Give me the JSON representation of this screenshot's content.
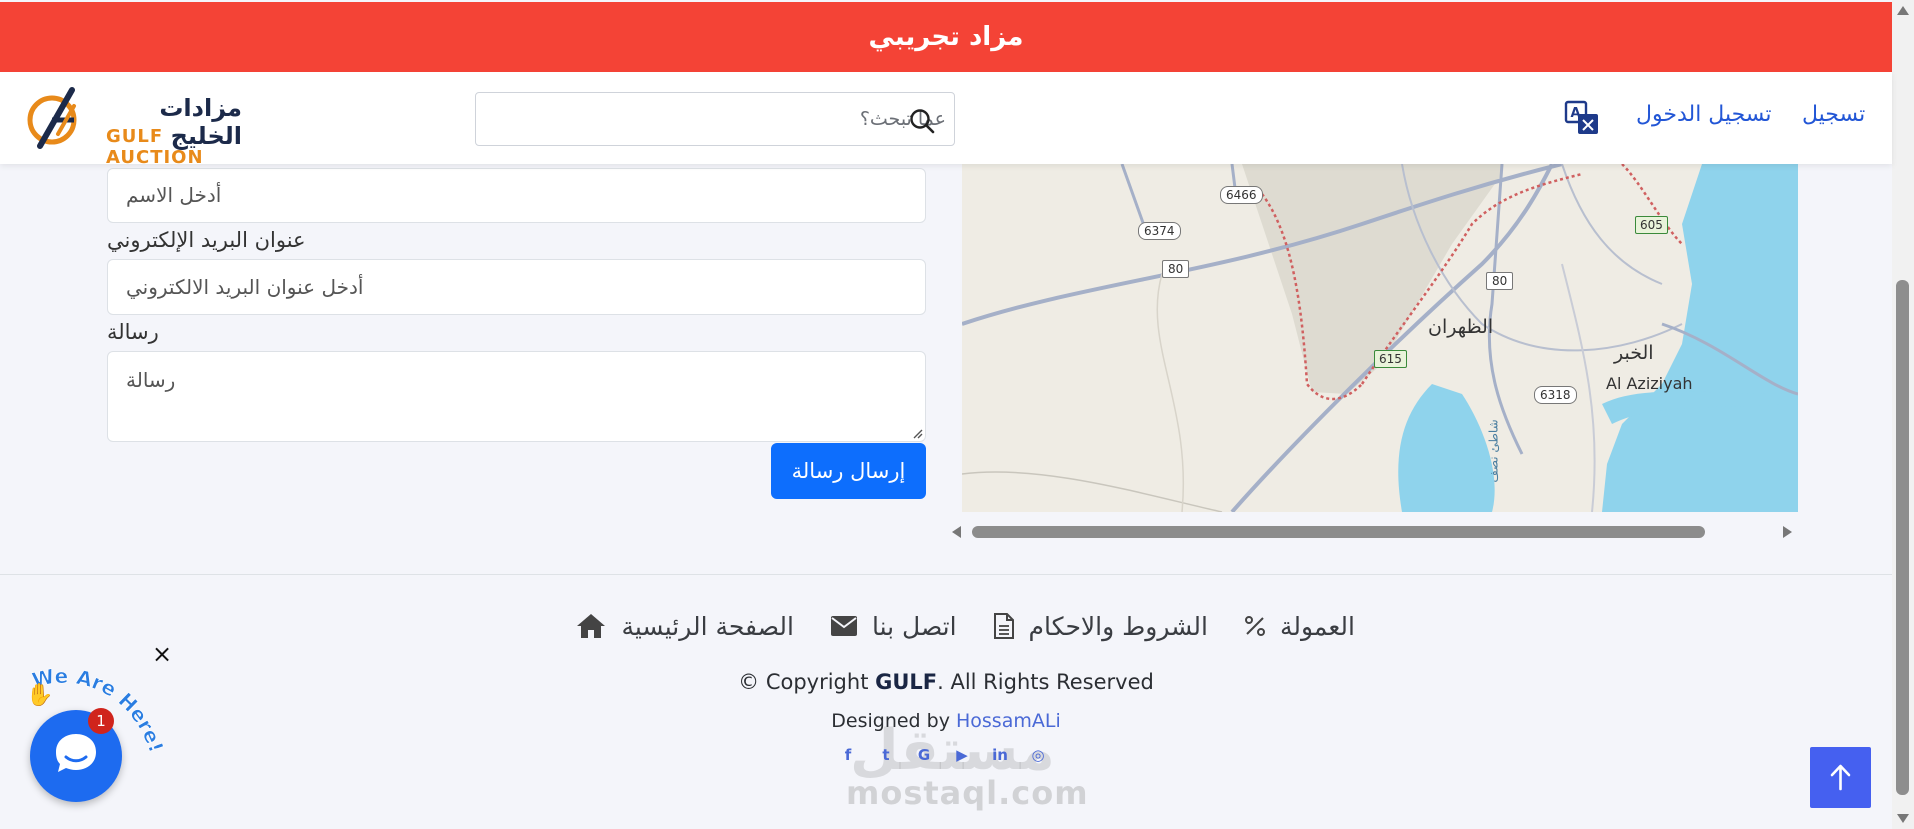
{
  "banner": {
    "text": "مزاد تجريبي"
  },
  "header": {
    "logo_ar": "مزادات الخليج",
    "logo_en": "GULF AUCTION",
    "search_placeholder": "عما تبحث؟",
    "login": "تسجيل الدخول",
    "register": "تسجيل"
  },
  "form": {
    "name_placeholder": "أدخل الاسم",
    "email_label": "عنوان البريد الإلكتروني",
    "email_placeholder": "أدخل عنوان البريد الالكتروني",
    "message_label": "رسالة",
    "message_placeholder": "رسالة",
    "send_label": "إرسال رسالة"
  },
  "map": {
    "labels": {
      "dhahran": "الظهران",
      "khobar": "الخبر",
      "aziziyah": "Al Aziziyah",
      "shore": "شاطئ نصف"
    },
    "roads": [
      "6466",
      "6374",
      "80",
      "80",
      "615",
      "605",
      "6318"
    ]
  },
  "footer": {
    "nav": {
      "home": "الصفحة الرئيسية",
      "contact": "اتصل بنا",
      "terms": "الشروط والاحكام",
      "commission": "العمولة"
    },
    "copyright_pre": "© Copyright ",
    "copyright_brand": "GULF",
    "copyright_post": ". All Rights Reserved",
    "designed_by": "Designed by ",
    "designer": "HossamALi",
    "social": [
      "f",
      "t",
      "G",
      "▶",
      "in",
      "◎"
    ]
  },
  "watermark": {
    "ar": "مستقل",
    "en": "mostaql.com"
  },
  "chat": {
    "badge": "1",
    "close": "×",
    "tagline": "We Are Here!"
  },
  "colors": {
    "banner": "#f44336",
    "primary": "#0d6efd",
    "link": "#2256d6",
    "to_top": "#4560f0"
  }
}
